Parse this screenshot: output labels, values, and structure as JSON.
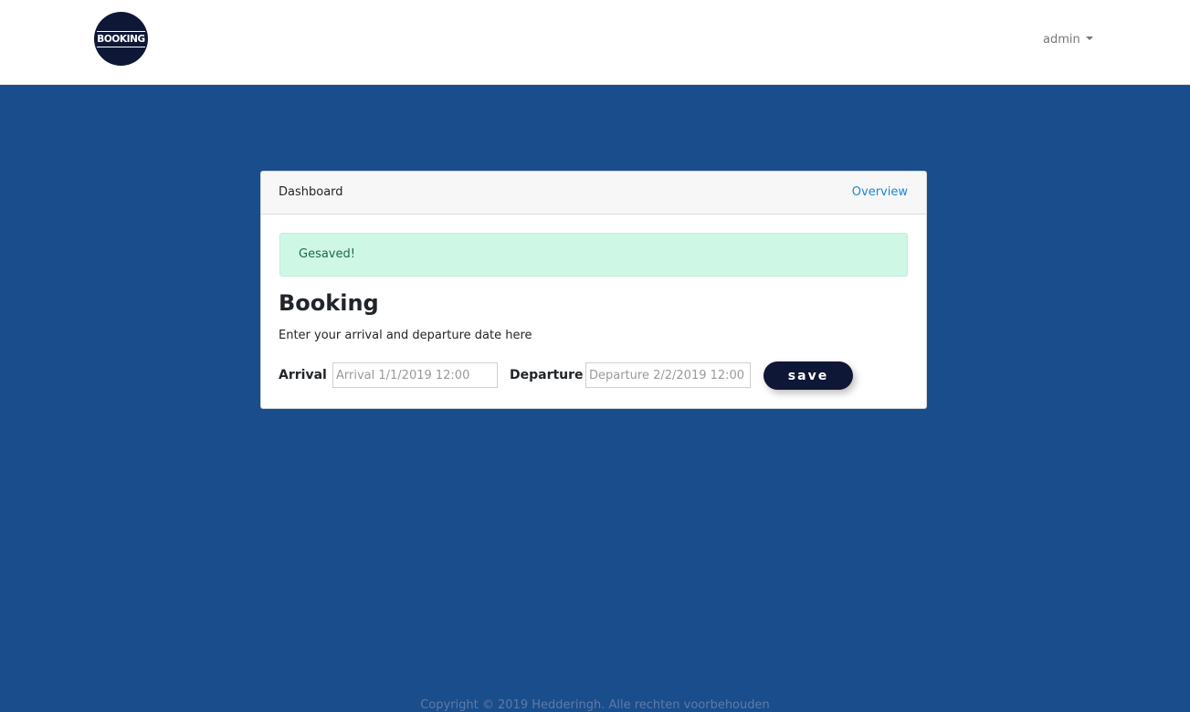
{
  "header": {
    "logo_text": "BOOKING",
    "user_menu_label": "admin"
  },
  "card": {
    "title": "Dashboard",
    "overview_link": "Overview",
    "alert_text": "Gesaved!",
    "heading": "Booking",
    "subtext": "Enter your arrival and departure date here"
  },
  "form": {
    "arrival_label": "Arrival",
    "arrival_placeholder": "Arrival 1/1/2019 12:00",
    "arrival_value": "",
    "departure_label": "Departure",
    "departure_placeholder": "Departure 2/2/2019 12:00",
    "departure_value": "",
    "save_label": "save"
  },
  "footer": {
    "copyright": "Copyright © 2019 Hedderingh. Alle rechten voorbehouden"
  },
  "colors": {
    "background": "#1a4d8c",
    "accent_dark": "#0f1736",
    "link": "#1e88d2",
    "alert_bg": "#cff7e6",
    "alert_text": "#1d6b45"
  },
  "icons": {
    "user_menu_caret": "caret-down-icon",
    "logo": "booking-logo"
  }
}
